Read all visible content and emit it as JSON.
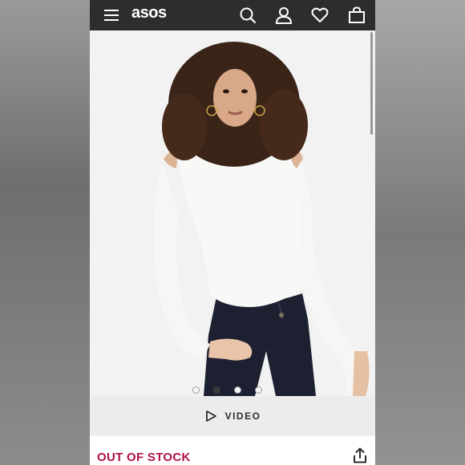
{
  "header": {
    "logo_text": "asos",
    "menu_icon": "hamburger-menu-icon",
    "search_icon": "search-icon",
    "account_icon": "account-icon",
    "wishlist_icon": "heart-icon",
    "bag_icon": "bag-icon"
  },
  "gallery": {
    "image_alt": "Model wearing white cold-shoulder bodysuit with navy jeans",
    "dots_total": 4,
    "active_dot": 2
  },
  "video": {
    "label": "VIDEO",
    "icon": "play-icon"
  },
  "product": {
    "stock_status": "OUT OF STOCK",
    "share_icon": "share-icon"
  },
  "colors": {
    "header_bg": "#2d2d2d",
    "oos_color": "#b0104a",
    "top_white": "#f8f8f6",
    "jeans_navy": "#1c2030"
  }
}
